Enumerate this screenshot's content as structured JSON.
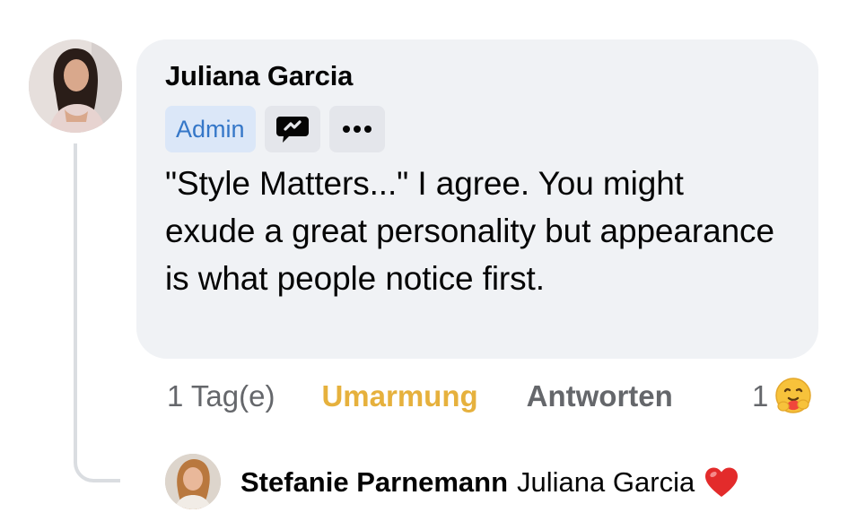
{
  "comment": {
    "author": "Juliana Garcia",
    "badge": "Admin",
    "badge_icon": "chat-bubble-icon",
    "more_icon": "ellipsis-icon",
    "text": "\"Style Matters...\" I agree. You might exude a great personality but appearance is what people notice first."
  },
  "actions": {
    "time": "1 Tag(e)",
    "react_label": "Umarmung",
    "reply_label": "Antworten",
    "reaction_count": "1",
    "reaction_icon": "care-hug-emoji-icon",
    "react_color": "#e6b13d"
  },
  "reply": {
    "author": "Stefanie Parnemann",
    "text": "Juliana Garcia",
    "emoji_icon": "red-heart-icon"
  },
  "colors": {
    "bubble": "#f0f2f5",
    "badge_bg": "#dbe7f8",
    "badge_text": "#3577c8",
    "muted": "#65676b"
  }
}
